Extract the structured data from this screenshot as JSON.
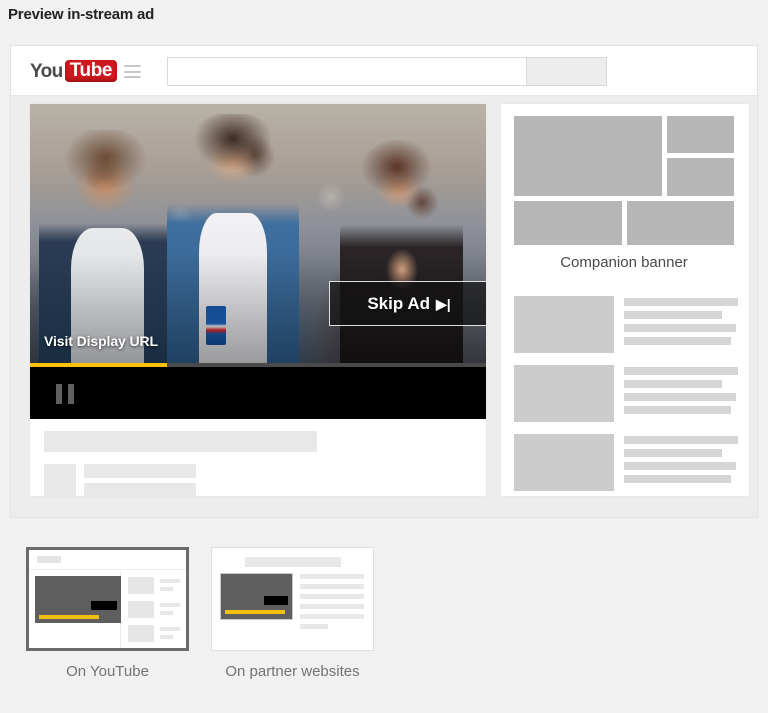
{
  "page": {
    "title": "Preview in-stream ad",
    "background_color": "#f1f1f1"
  },
  "youtube_chrome": {
    "logo": {
      "you": "You",
      "tube": "Tube",
      "brand_color": "#cc181e"
    },
    "menu_icon": "hamburger-icon",
    "search": {
      "value": "",
      "placeholder": ""
    },
    "search_button_label": ""
  },
  "player": {
    "display_url_label": "Visit Display URL",
    "skip_ad_label": "Skip Ad",
    "skip_ad_glyph": "▶｜",
    "progress_percent": 30,
    "progress_color": "#ffc107",
    "playback_state": "paused",
    "pause_icon": "pause-icon"
  },
  "companion": {
    "caption": "Companion banner",
    "block_color": "#b6b6b6",
    "blocks": [
      "banner-block-large",
      "banner-block-top-right",
      "banner-block-mid-right",
      "banner-block-bottom-left",
      "banner-block-bottom-right"
    ]
  },
  "suggested_videos": {
    "items": [
      {
        "name": "suggested-video-1"
      },
      {
        "name": "suggested-video-2"
      },
      {
        "name": "suggested-video-3"
      }
    ]
  },
  "video_meta": {
    "title_placeholder": "",
    "channel_placeholder": ""
  },
  "placement_thumbnails": {
    "selected": "On YouTube",
    "items": [
      {
        "label": "On YouTube",
        "selected": true,
        "name": "thumbnail-on-youtube"
      },
      {
        "label": "On partner websites",
        "selected": false,
        "name": "thumbnail-on-partner-websites"
      }
    ]
  }
}
